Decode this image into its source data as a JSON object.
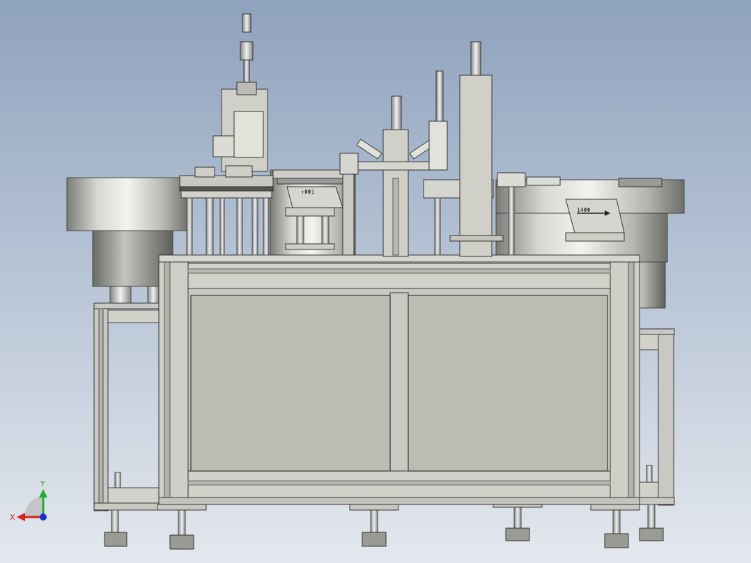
{
  "colors": {
    "background_top": "#8fa2bd",
    "background_bottom": "#e4e8ee",
    "frame": "#c9c8c2",
    "frame_dark": "#a8a7a0",
    "panel": "#bdbcb3",
    "edge": "#3a3a3a",
    "axis_x": "#d42020",
    "axis_y": "#1fae2f",
    "axis_z": "#1a2fd0"
  },
  "annotations": {
    "left_bowl_arrow": "↑ΦΦ1",
    "right_bowl_arrow": "14ΦΦ"
  },
  "triad": {
    "x_label": "X",
    "y_label": "Y"
  }
}
